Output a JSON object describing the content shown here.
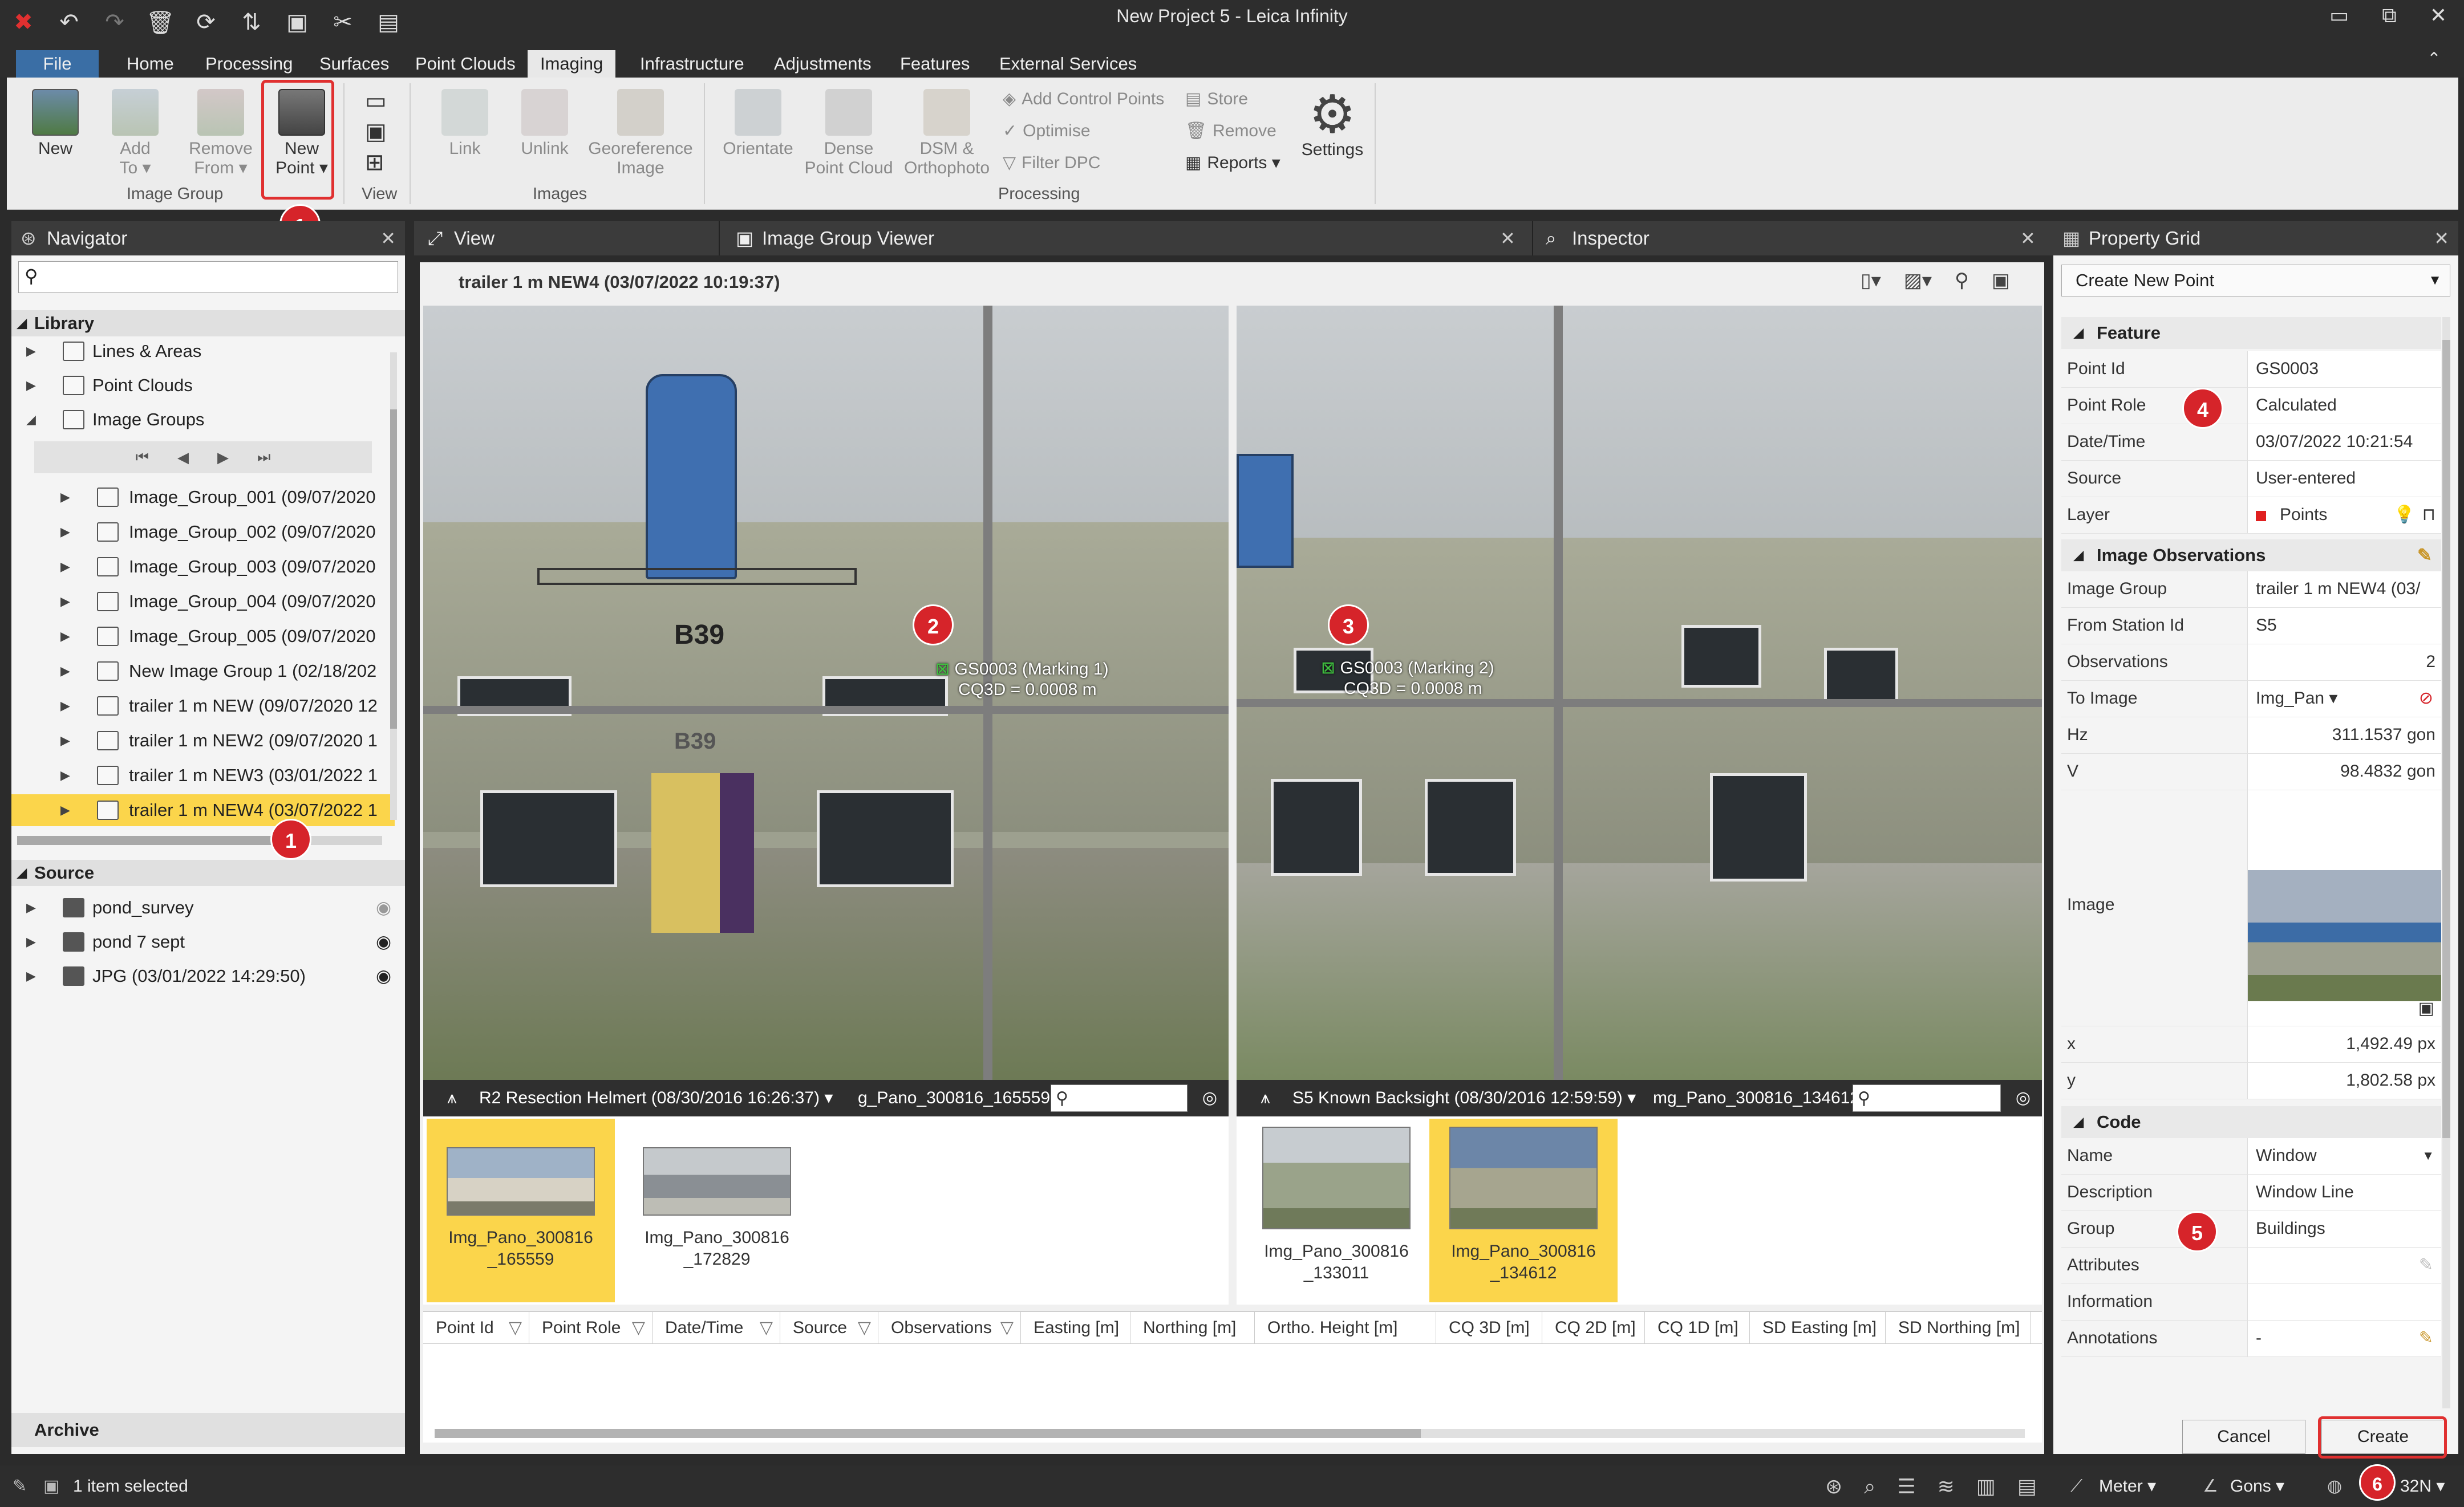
{
  "window": {
    "title": "New Project 5 - Leica Infinity",
    "min": "▭",
    "max": "⧉",
    "close": "✕",
    "collapse": "⌃"
  },
  "quick_access": [
    "app-logo-icon",
    "undo-icon",
    "redo-icon",
    "delete-icon",
    "refresh-icon",
    "sync-icon",
    "camera-icon",
    "tools-icon",
    "layout-icon"
  ],
  "menu": {
    "tabs": [
      "File",
      "Home",
      "Processing",
      "Surfaces",
      "Point Clouds",
      "Imaging",
      "Infrastructure",
      "Adjustments",
      "Features",
      "External Services"
    ],
    "active": "Imaging"
  },
  "ribbon": {
    "new": "New",
    "add_to_1": "Add",
    "add_to_2": "To ▾",
    "remove_from_1": "Remove",
    "remove_from_2": "From ▾",
    "new_point_1": "New",
    "new_point_2": "Point ▾",
    "group_image_group": "Image Group",
    "group_view": "View",
    "link": "Link",
    "unlink": "Unlink",
    "georef_1": "Georeference",
    "georef_2": "Image",
    "group_images": "Images",
    "orientate": "Orientate",
    "dense_1": "Dense",
    "dense_2": "Point Cloud",
    "dsm_1": "DSM &",
    "dsm_2": "Orthophoto",
    "add_control_points": "Add Control Points",
    "optimise": "Optimise",
    "filter_dpc": "Filter DPC",
    "store": "Store",
    "remove": "Remove",
    "reports": "Reports ▾",
    "settings": "Settings",
    "group_processing": "Processing"
  },
  "badges": {
    "b1": "1",
    "b2": "2",
    "b3": "3",
    "b4": "4",
    "b5": "5",
    "b6": "6"
  },
  "navigator": {
    "title": "Navigator",
    "close": "✕",
    "library": "Library",
    "items": [
      {
        "label": "Lines & Areas",
        "exp": "▶"
      },
      {
        "label": "Point Clouds",
        "exp": "▶"
      },
      {
        "label": "Image Groups",
        "exp": "◢"
      }
    ],
    "pager": [
      "⏮",
      "◀",
      "▶",
      "⏭"
    ],
    "groups": [
      "Image_Group_001 (09/07/2020",
      "Image_Group_002 (09/07/2020",
      "Image_Group_003 (09/07/2020",
      "Image_Group_004 (09/07/2020",
      "Image_Group_005 (09/07/2020",
      "New Image Group 1 (02/18/202",
      "trailer 1 m NEW (09/07/2020 12",
      "trailer 1 m NEW2 (09/07/2020 1",
      "trailer 1 m NEW3 (03/01/2022 1",
      "trailer 1 m NEW4 (03/07/2022 1"
    ],
    "source_title": "Source",
    "sources": [
      "pond_survey",
      "pond 7 sept",
      "JPG (03/01/2022 14:29:50)"
    ],
    "archive": "Archive"
  },
  "view_tabs": {
    "view": "View",
    "image_group_viewer": "Image Group Viewer",
    "inspector": "Inspector",
    "close": "✕"
  },
  "viewer": {
    "group_title": "trailer 1 m NEW4 (03/07/2022 10:19:37)",
    "left": {
      "station": "R2 Resection Helmert (08/30/2016 16:26:37)  ▾",
      "image": "g_Pano_300816_165559",
      "mark_1": "GS0003 (Marking 1)",
      "mark_2": "CQ3D = 0.0008 m",
      "label": "B39",
      "label_2": "B39"
    },
    "right": {
      "station": "S5 Known Backsight (08/30/2016 12:59:59)  ▾",
      "image": "mg_Pano_300816_134612",
      "mark_1": "GS0003 (Marking 2)",
      "mark_2": "CQ3D = 0.0008 m"
    },
    "thumbs_left": [
      {
        "l1": "Img_Pano_300816",
        "l2": "_165559"
      },
      {
        "l1": "Img_Pano_300816",
        "l2": "_172829"
      }
    ],
    "thumbs_right": [
      {
        "l1": "Img_Pano_300816",
        "l2": "_133011"
      },
      {
        "l1": "Img_Pano_300816",
        "l2": "_134612"
      }
    ],
    "columns": [
      "Point Id",
      "Point Role",
      "Date/Time",
      "Source",
      "Observations",
      "Easting [m]",
      "Northing [m]",
      "Ortho. Height [m]",
      "CQ 3D [m]",
      "CQ 2D [m]",
      "CQ 1D [m]",
      "SD Easting [m]",
      "SD Northing [m]",
      "SD"
    ]
  },
  "property_grid": {
    "title": "Property Grid",
    "close": "✕",
    "mode": "Create New Point",
    "feature": "Feature",
    "rows_feature": [
      {
        "k": "Point Id",
        "v": "GS0003"
      },
      {
        "k": "Point Role",
        "v": "Calculated"
      },
      {
        "k": "Date/Time",
        "v": "03/07/2022 10:21:54"
      },
      {
        "k": "Source",
        "v": "User-entered"
      },
      {
        "k": "Layer",
        "v": "Points"
      }
    ],
    "image_obs": "Image Observations",
    "rows_obs": [
      {
        "k": "Image Group",
        "v": "trailer 1 m NEW4 (03/"
      },
      {
        "k": "From Station Id",
        "v": "S5"
      },
      {
        "k": "Observations",
        "v": "2"
      },
      {
        "k": "To Image",
        "v": "Img_Pan ▾"
      },
      {
        "k": "Hz",
        "v": "311.1537 gon"
      },
      {
        "k": "V",
        "v": "98.4832 gon"
      }
    ],
    "image_label": "Image",
    "x_label": "x",
    "x_val": "1,492.49 px",
    "y_label": "y",
    "y_val": "1,802.58 px",
    "code": "Code",
    "rows_code": [
      {
        "k": "Name",
        "v": "Window"
      },
      {
        "k": "Description",
        "v": "Window Line"
      },
      {
        "k": "Group",
        "v": "Buildings"
      },
      {
        "k": "Attributes",
        "v": ""
      },
      {
        "k": "Information",
        "v": ""
      },
      {
        "k": "Annotations",
        "v": "-"
      }
    ],
    "cancel": "Cancel",
    "create": "Create"
  },
  "status": {
    "selected": "1 item selected",
    "units": "Meter ▾",
    "angle": "Gons ▾",
    "crs": "32N ▾"
  },
  "colors": {
    "accent": "#3a6ea5",
    "highlight": "#fbd54b",
    "badge": "#d6242a"
  }
}
